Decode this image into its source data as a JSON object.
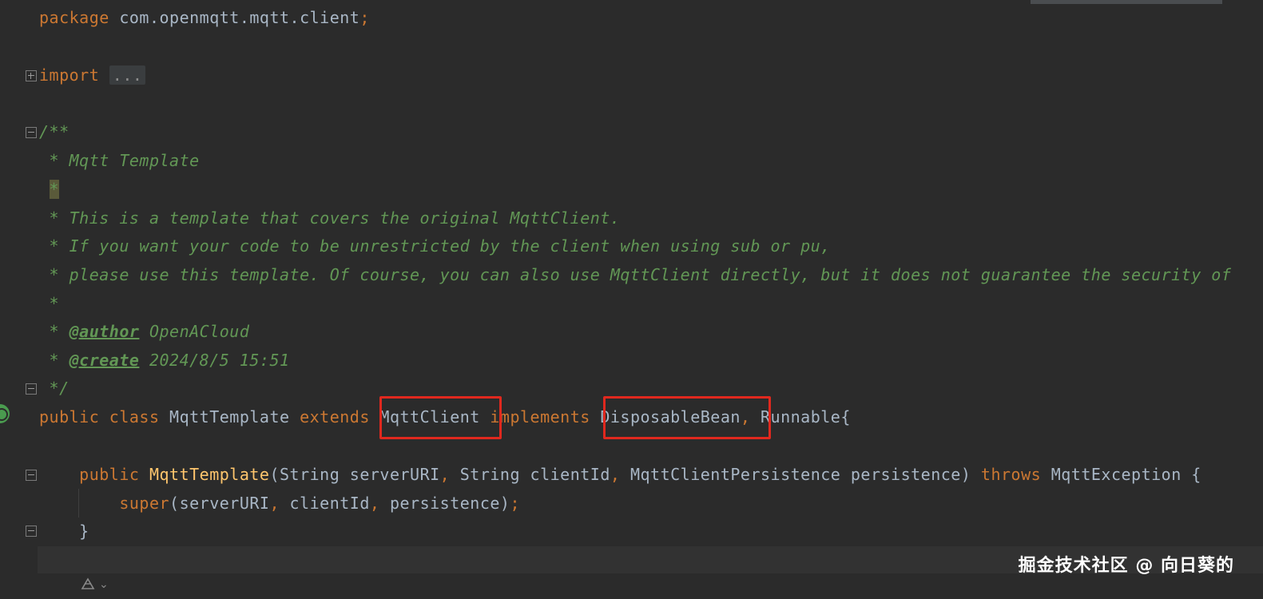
{
  "code": {
    "l1": {
      "kw": "package",
      "rest": " com.openmqtt.mqtt.client",
      "semi": ";"
    },
    "l2": {
      "kw": "import",
      "dots": "..."
    },
    "l3": {
      "open": "/**"
    },
    "l4": {
      "text": " * Mqtt Template"
    },
    "l5": {
      "star": "*"
    },
    "l6": {
      "text": " * This is a template that covers the original MqttClient."
    },
    "l7": {
      "text": " * If you want your code to be unrestricted by the client when using sub or pu,"
    },
    "l8": {
      "text": " * please use this template. Of course, you can also use MqttClient directly, but it does not guarantee the security of"
    },
    "l9": {
      "text": " *"
    },
    "l10": {
      "prefix": " * ",
      "tag": "@author",
      "value": " OpenACloud"
    },
    "l11": {
      "prefix": " * ",
      "tag": "@create",
      "value": " 2024/8/5 15:51"
    },
    "l12": {
      "close": " */"
    },
    "l13": {
      "kw1": "public class",
      "name": " MqttTemplate ",
      "kw2": "extends",
      "sup": " MqttClient ",
      "kw3": "implements",
      "iface1": " DisposableBean",
      "comma": ",",
      "iface2": " Runnable{"
    },
    "l14": {
      "indent": "    ",
      "kw": "public",
      "fn": " MqttTemplate",
      "p1": "(String serverURI",
      "c1": ",",
      "p2": " String clientId",
      "c2": ",",
      "p3": " MqttClientPersistence persistence) ",
      "kw2": "throws",
      "p4": " MqttException {"
    },
    "l15": {
      "indent": "        ",
      "fn": "super",
      "p1": "(serverURI",
      "c1": ",",
      "p2": " clientId",
      "c2": ",",
      "p3": " persistence)",
      "semi": ";"
    },
    "l16": {
      "text": "    }"
    }
  },
  "inlay_hint": {
    "icon": "ai-assistant-icon",
    "chevron": "⌄"
  },
  "watermark": "掘金技术社区 @ 向日葵的",
  "colors": {
    "keyword": "#cc7832",
    "doc": "#629755",
    "function": "#ffc66d",
    "text": "#a9b7c6",
    "highlight_box": "#e0281e",
    "background": "#2b2b2b"
  }
}
